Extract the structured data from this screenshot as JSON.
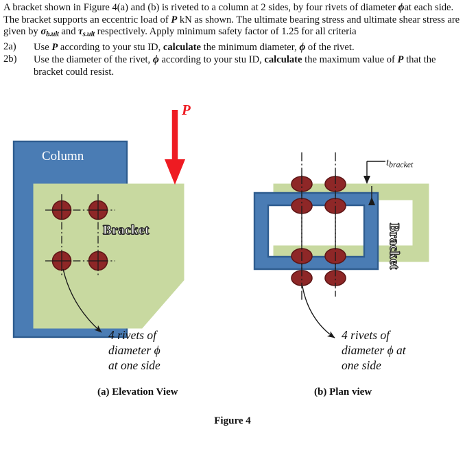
{
  "statement": {
    "intro_lines": [
      "A bracket shown in Figure 4(a) and (b) is riveted to a column at 2 sides, by four rivets of diameter ",
      "at each side. The bracket supports an eccentric load of ",
      " kN as shown. The ultimate bearing stress and ultimate shear stress are given by ",
      " and ",
      " respectively. Apply minimum safety factor of 1.25 for all criteria"
    ],
    "symbols": {
      "phi": "ϕ",
      "P": "P",
      "sigma": "σ",
      "sigma_sub": "b.ult",
      "tau": "τ",
      "tau_sub": "s.ult"
    },
    "questions": [
      {
        "label": "2a)",
        "parts": [
          "Use ",
          "P",
          " according to your stu ID, ",
          "calculate",
          " the minimum diameter, ",
          "ϕ",
          " of the rivet."
        ]
      },
      {
        "label": "2b)",
        "parts": [
          "Use the diameter of the rivet, ",
          "ϕ",
          " according to your stu ID, ",
          "calculate",
          " the maximum value of ",
          "P",
          " that the bracket could resist."
        ]
      }
    ]
  },
  "figure": {
    "caption": "Figure 4",
    "elevation": {
      "column_label": "Column",
      "bracket_label": "Bracket",
      "load_label": "P",
      "callout_lines": [
        "4 rivets of",
        "diameter ϕ",
        "at one side"
      ],
      "view_caption": "(a)  Elevation View",
      "rivet_count": 4
    },
    "plan": {
      "bracket_label": "Bracket",
      "thickness_label": "t",
      "thickness_sub": "bracket",
      "callout_lines": [
        "4 rivets of",
        "diameter ϕ at",
        "one side"
      ],
      "view_caption": "(b) Plan view",
      "rivet_count": 8
    },
    "colors": {
      "column_fill": "#4a7cb4",
      "column_stroke": "#2e5c8f",
      "bracket_fill": "#c8d9a0",
      "bracket_stroke": "#c8d9a0",
      "rivet_fill": "#8e2727",
      "rivet_stroke": "#5e1616",
      "load_arrow": "#ee1b22",
      "centerline": "#1a1a1a",
      "leader": "#1a1a1a"
    }
  }
}
